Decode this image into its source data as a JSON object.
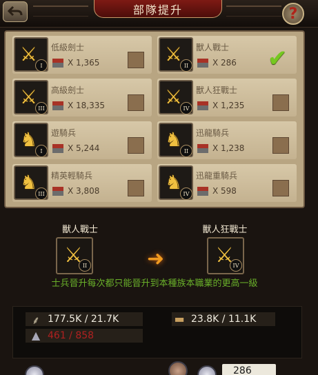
{
  "header": {
    "title": "部隊提升"
  },
  "units": [
    {
      "name": "低級劍士",
      "count": "X 1,365",
      "tier": "I",
      "glyph": "⚔",
      "selected": false
    },
    {
      "name": "獸人戰士",
      "count": "X 286",
      "tier": "II",
      "glyph": "⚔",
      "selected": true
    },
    {
      "name": "高級劍士",
      "count": "X 18,335",
      "tier": "III",
      "glyph": "⚔",
      "selected": false
    },
    {
      "name": "獸人狂戰士",
      "count": "X 1,235",
      "tier": "IV",
      "glyph": "⚔",
      "selected": false
    },
    {
      "name": "遊騎兵",
      "count": "X 5,244",
      "tier": "I",
      "glyph": "♞",
      "selected": false
    },
    {
      "name": "迅龍騎兵",
      "count": "X 1,238",
      "tier": "II",
      "glyph": "♞",
      "selected": false
    },
    {
      "name": "精英輕騎兵",
      "count": "X 3,808",
      "tier": "III",
      "glyph": "♞",
      "selected": false
    },
    {
      "name": "迅龍重騎兵",
      "count": "X 598",
      "tier": "IV",
      "glyph": "♞",
      "selected": false
    }
  ],
  "upgrade": {
    "from": {
      "name": "獸人戰士",
      "tier": "II"
    },
    "to": {
      "name": "獸人狂戰士",
      "tier": "IV"
    },
    "note": "士兵晉升每次都只能晉升到本種族本職業的更高一級"
  },
  "resources": {
    "food": "177.5K / 21.7K",
    "wood": "23.8K / 11.1K",
    "iron": "461 / 858"
  },
  "bottom": {
    "count_value": "286"
  },
  "icons": {
    "back": "back-arrow-icon",
    "help": "question-icon",
    "check": "checkmark-icon"
  },
  "colors": {
    "accent_red": "#7e1a14",
    "check_green": "#76c820",
    "note_green": "#6ab02a",
    "deficit_red": "#b02020"
  }
}
